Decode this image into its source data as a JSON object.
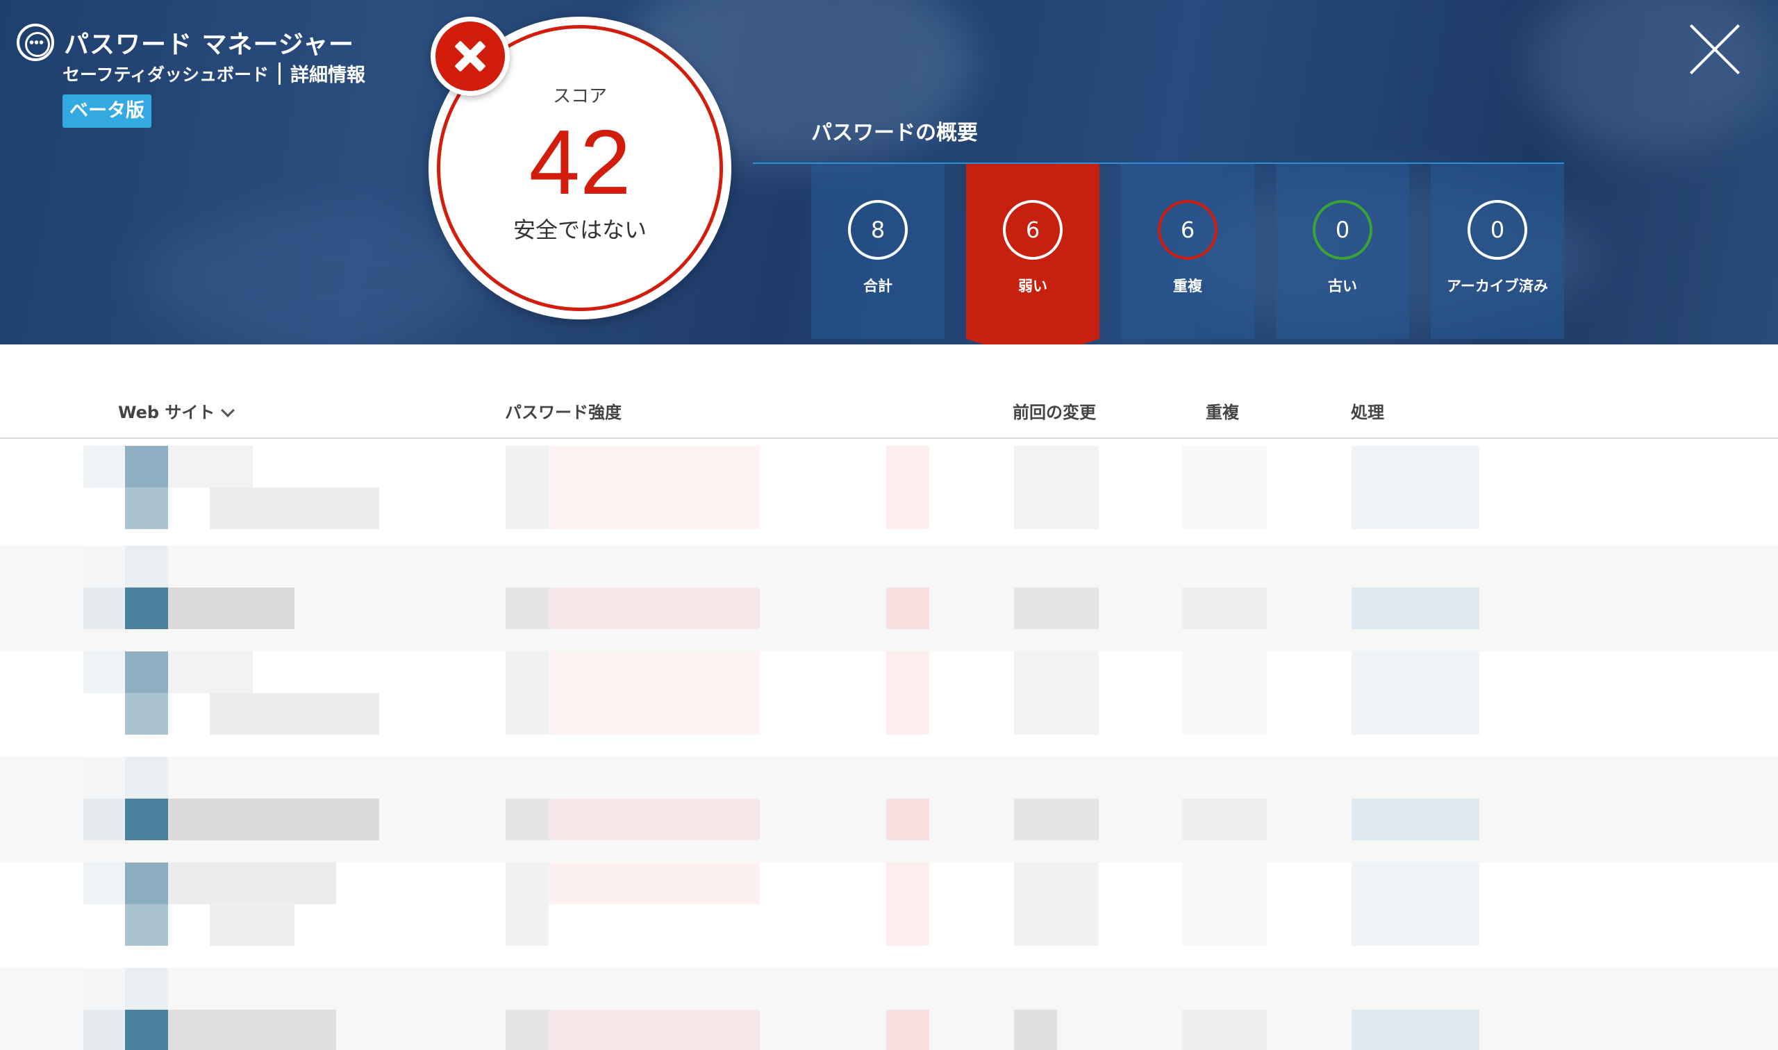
{
  "app": {
    "title": "パスワード マネージャー",
    "subnav_link": "セーフティダッシュボード",
    "subnav_current": "詳細情報",
    "beta_label": "ベータ版"
  },
  "score": {
    "label": "スコア",
    "value": "42",
    "status": "安全ではない"
  },
  "overview": {
    "title": "パスワードの概要",
    "tiles": [
      {
        "count": "8",
        "label": "合計",
        "ring_color": "#ffffff",
        "active": false
      },
      {
        "count": "6",
        "label": "弱い",
        "ring_color": "#ffffff",
        "active": true
      },
      {
        "count": "6",
        "label": "重複",
        "ring_color": "#d21d0c",
        "active": false
      },
      {
        "count": "0",
        "label": "古い",
        "ring_color": "#3aa335",
        "active": false
      },
      {
        "count": "0",
        "label": "アーカイブ済み",
        "ring_color": "#ffffff",
        "active": false
      }
    ]
  },
  "table": {
    "columns": {
      "website": "Web サイト",
      "strength": "パスワード強度",
      "last_changed": "前回の変更",
      "duplicate": "重複",
      "action": "処理"
    }
  },
  "colors": {
    "danger": "#d21d0c",
    "accent": "#33a9e2",
    "header_bg": "#1f3f6d"
  }
}
